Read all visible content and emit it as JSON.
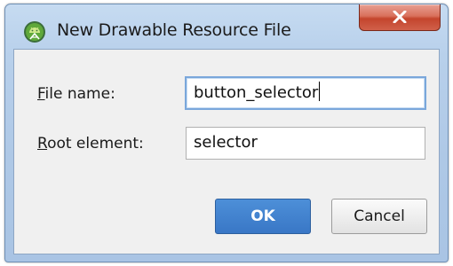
{
  "window": {
    "title": "New Drawable Resource File",
    "close_icon": "close-x-icon",
    "app_icon": "android-studio-icon"
  },
  "form": {
    "file_name": {
      "label_mnemonic": "F",
      "label_rest": "ile name:",
      "value": "button_selector"
    },
    "root_element": {
      "label_mnemonic": "R",
      "label_rest": "oot element:",
      "value": "selector"
    }
  },
  "buttons": {
    "ok_label": "OK",
    "cancel_label": "Cancel"
  },
  "colors": {
    "primary_button": "#3977c6",
    "close_button": "#c4452d",
    "focus_border": "#7aa7db"
  }
}
